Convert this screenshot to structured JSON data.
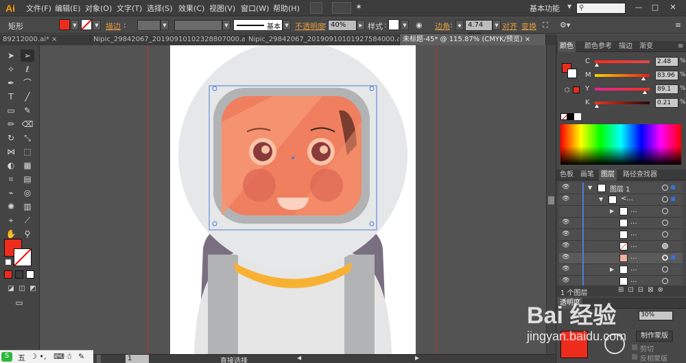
{
  "app": {
    "logo": "Ai"
  },
  "menu": [
    "文件(F)",
    "编辑(E)",
    "对象(O)",
    "文字(T)",
    "选择(S)",
    "效果(C)",
    "视图(V)",
    "窗口(W)",
    "帮助(H)"
  ],
  "workspace": "基本功能",
  "control": {
    "object_type": "矩形",
    "stroke_label": "描边",
    "stroke_style": "基本",
    "opacity_label": "不透明度",
    "opacity_value": "40%",
    "style_label": "样式",
    "corner_label": "边角",
    "corner_value": "4.74 mm",
    "align_label": "对齐",
    "transform_label": "变换",
    "fill_color": "#ee2c1e"
  },
  "tabs": [
    {
      "label": "89212000.ai*",
      "active": false
    },
    {
      "label": "Nipic_29842067_20190910102328807000.ai*",
      "active": false
    },
    {
      "label": "Nipic_29842067_20190910101927584000.ai*",
      "active": false
    },
    {
      "label": "未标题-45* @ 115.87% (CMYK/预览)",
      "active": true
    }
  ],
  "color_panel": {
    "tabs": [
      "颜色",
      "颜色参考",
      "描边",
      "渐变"
    ],
    "sliders": [
      {
        "name": "C",
        "value": "2.48",
        "level": 0.02
      },
      {
        "name": "M",
        "value": "83.96",
        "level": 0.84
      },
      {
        "name": "Y",
        "value": "89.1",
        "level": 0.89
      },
      {
        "name": "K",
        "value": "0.21",
        "level": 0.0
      }
    ],
    "pct": "%"
  },
  "layers_panel": {
    "tabs": [
      "色板",
      "画笔",
      "图层",
      "路径查找器"
    ],
    "top_layer": "图层 1",
    "group_label": "<...",
    "item_label": "...",
    "count": "1 个图层"
  },
  "transparency": {
    "title": "透明度",
    "opacity": "30%",
    "make_mask": "制作蒙版",
    "clip": "剪切",
    "invert": "反相蒙版"
  },
  "status": {
    "zoom_value": "1",
    "tool_name": "直接选择"
  },
  "watermark": {
    "logo": "Bai 经验",
    "url": "jingyan.baidu.com"
  },
  "artwork": {
    "helmet": "#e6e7e9",
    "visor_frame": "#b2b3b5",
    "face": "#f07f5f",
    "suit": "#e6e6e6",
    "collar": "#f8b233",
    "backpack": "#7a6f80",
    "strap": "#b2b3b5"
  }
}
